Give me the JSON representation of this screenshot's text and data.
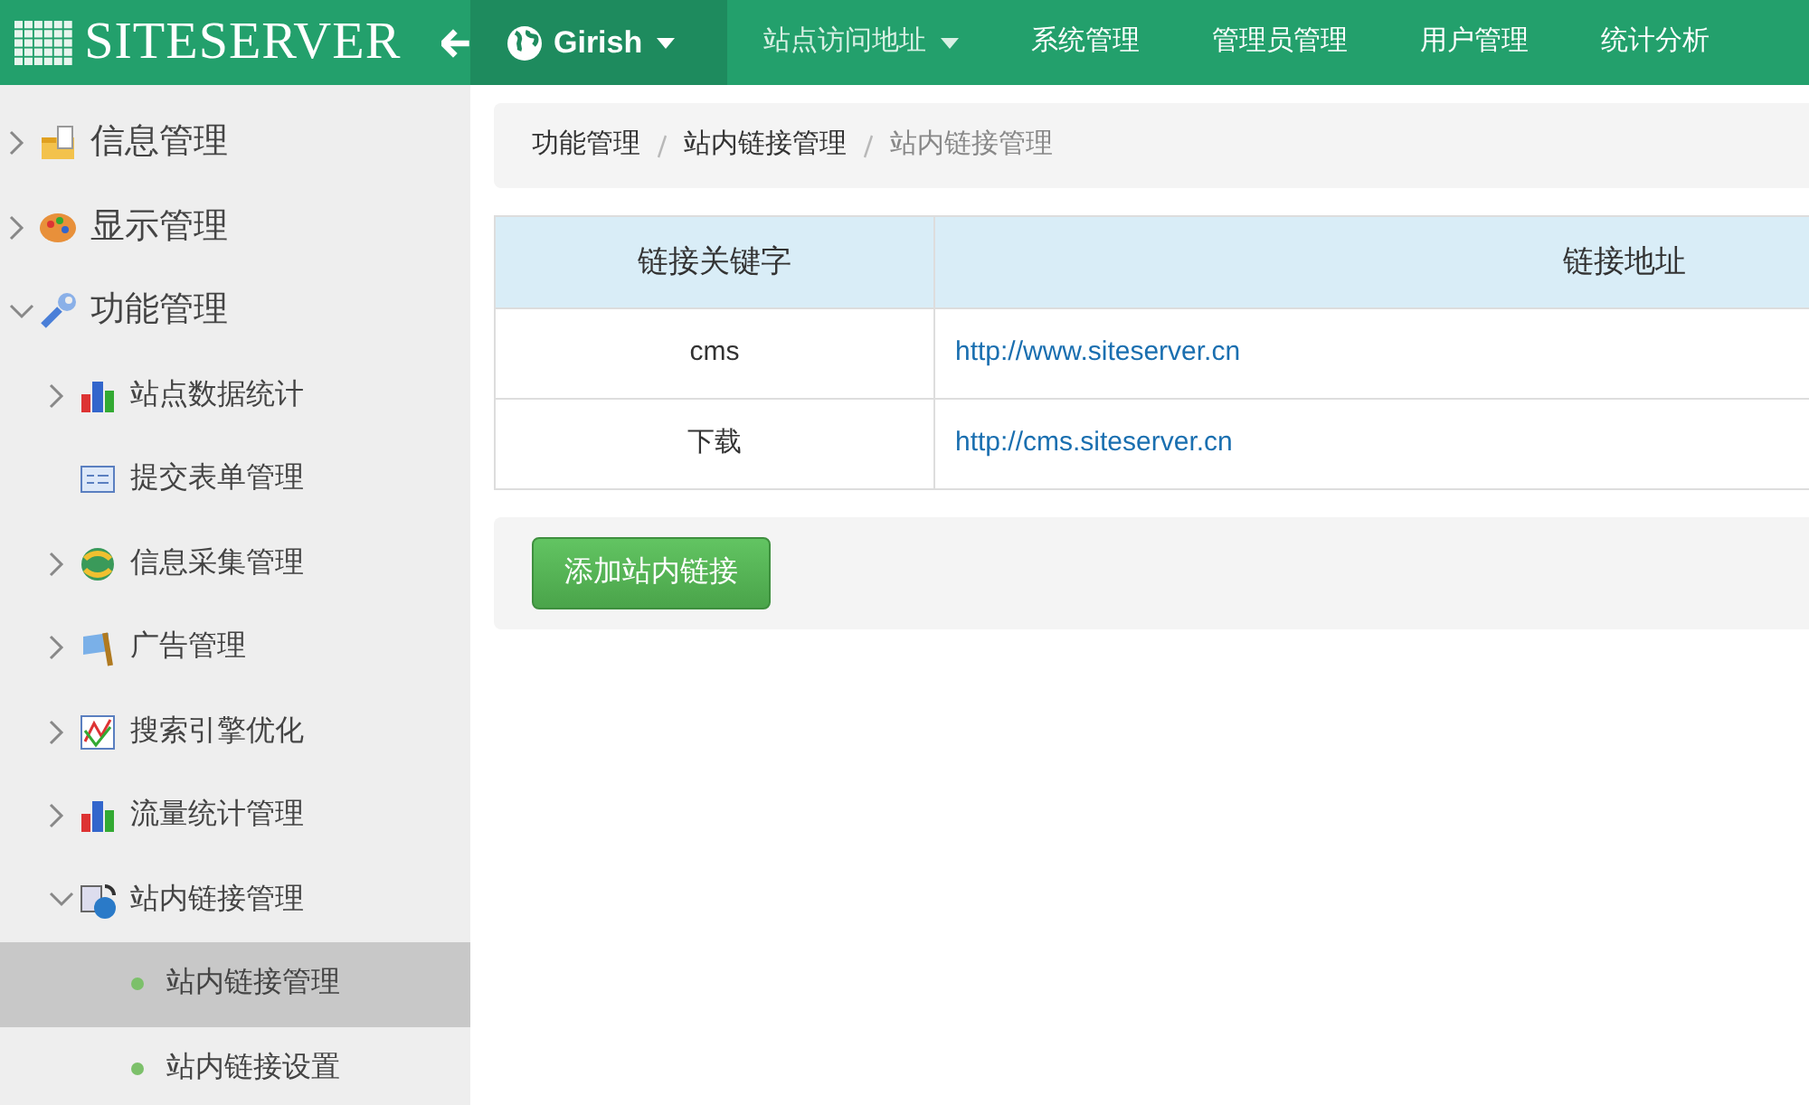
{
  "header": {
    "logo": "SITESERVER",
    "site_switcher": {
      "label": "Girish"
    },
    "nav_items": [
      {
        "label": "站点访问地址",
        "dropdown": true
      },
      {
        "label": "系统管理",
        "dropdown": false
      },
      {
        "label": "管理员管理",
        "dropdown": false
      },
      {
        "label": "用户管理",
        "dropdown": false
      },
      {
        "label": "统计分析",
        "dropdown": false
      }
    ]
  },
  "sidebar": {
    "items": [
      {
        "label": "信息管理",
        "kind": "group",
        "expanded": false
      },
      {
        "label": "显示管理",
        "kind": "group",
        "expanded": false
      },
      {
        "label": "功能管理",
        "kind": "group",
        "expanded": true,
        "children": [
          {
            "label": "站点数据统计",
            "kind": "group",
            "expanded": false
          },
          {
            "label": "提交表单管理",
            "kind": "leaf"
          },
          {
            "label": "信息采集管理",
            "kind": "group",
            "expanded": false
          },
          {
            "label": "广告管理",
            "kind": "group",
            "expanded": false
          },
          {
            "label": "搜索引擎优化",
            "kind": "group",
            "expanded": false
          },
          {
            "label": "流量统计管理",
            "kind": "group",
            "expanded": false
          },
          {
            "label": "站内链接管理",
            "kind": "group",
            "expanded": true,
            "children": [
              {
                "label": "站内链接管理",
                "kind": "link",
                "selected": true
              },
              {
                "label": "站内链接设置",
                "kind": "link",
                "selected": false
              }
            ]
          }
        ]
      }
    ]
  },
  "breadcrumb": [
    "功能管理",
    "站内链接管理",
    "站内链接管理"
  ],
  "table": {
    "columns": [
      "链接关键字",
      "链接地址"
    ],
    "rows": [
      [
        "cms",
        "http://www.siteserver.cn"
      ],
      [
        "下载",
        "http://cms.siteserver.cn"
      ]
    ]
  },
  "add_button": "添加站内链接"
}
